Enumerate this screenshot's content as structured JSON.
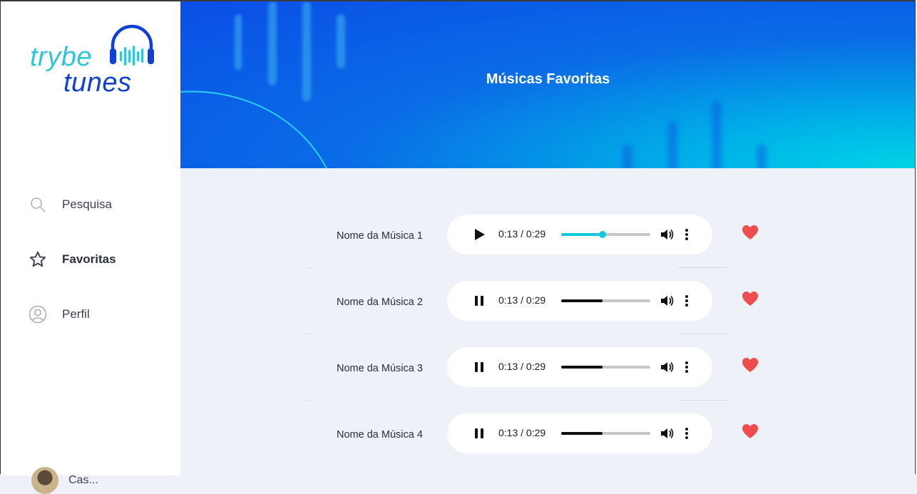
{
  "app": {
    "logo_word1": "trybe",
    "logo_word2": "tunes"
  },
  "sidebar": {
    "items": [
      {
        "label": "Pesquisa",
        "icon": "search-icon",
        "active": false
      },
      {
        "label": "Favoritas",
        "icon": "star-icon",
        "active": true
      },
      {
        "label": "Perfil",
        "icon": "user-circle-icon",
        "active": false
      }
    ],
    "user_name": "Cas..."
  },
  "header": {
    "title": "Músicas Favoritas"
  },
  "songs": [
    {
      "name": "Nome da Música 1",
      "time": "0:13 / 0:29",
      "state": "paused",
      "progress": 0.45,
      "favorite": true
    },
    {
      "name": "Nome da Música 2",
      "time": "0:13 / 0:29",
      "state": "playing",
      "progress": 0.45,
      "favorite": true
    },
    {
      "name": "Nome da Música 3",
      "time": "0:13 / 0:29",
      "state": "playing",
      "progress": 0.45,
      "favorite": true
    },
    {
      "name": "Nome da Música 4",
      "time": "0:13 / 0:29",
      "state": "playing",
      "progress": 0.45,
      "favorite": true
    }
  ],
  "colors": {
    "accent_cyan": "#12c9dc",
    "brand_blue": "#0f3fd6",
    "heart_red": "#ef4d4d"
  }
}
